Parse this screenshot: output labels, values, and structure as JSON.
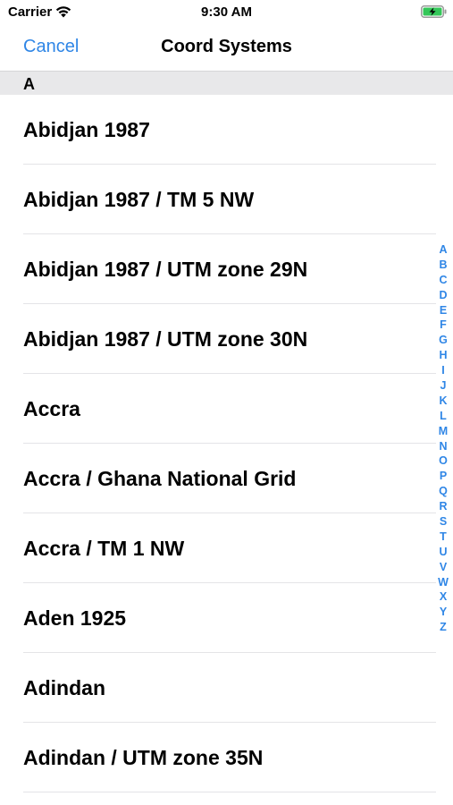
{
  "status_bar": {
    "carrier": "Carrier",
    "time": "9:30 AM",
    "battery_color": "#34c759",
    "icons": [
      "wifi-icon",
      "battery-charging-icon"
    ]
  },
  "nav": {
    "cancel_label": "Cancel",
    "title": "Coord Systems",
    "accent_color": "#2f86e6"
  },
  "section": {
    "letter": "A"
  },
  "items": [
    "Abidjan 1987",
    "Abidjan 1987 / TM 5 NW",
    "Abidjan 1987 / UTM zone 29N",
    "Abidjan 1987 / UTM zone 30N",
    "Accra",
    "Accra / Ghana National Grid",
    "Accra / TM 1 NW",
    "Aden 1925",
    "Adindan",
    "Adindan / UTM zone 35N"
  ],
  "index_letters": [
    "A",
    "B",
    "C",
    "D",
    "E",
    "F",
    "G",
    "H",
    "I",
    "J",
    "K",
    "L",
    "M",
    "N",
    "O",
    "P",
    "Q",
    "R",
    "S",
    "T",
    "U",
    "V",
    "W",
    "X",
    "Y",
    "Z"
  ]
}
